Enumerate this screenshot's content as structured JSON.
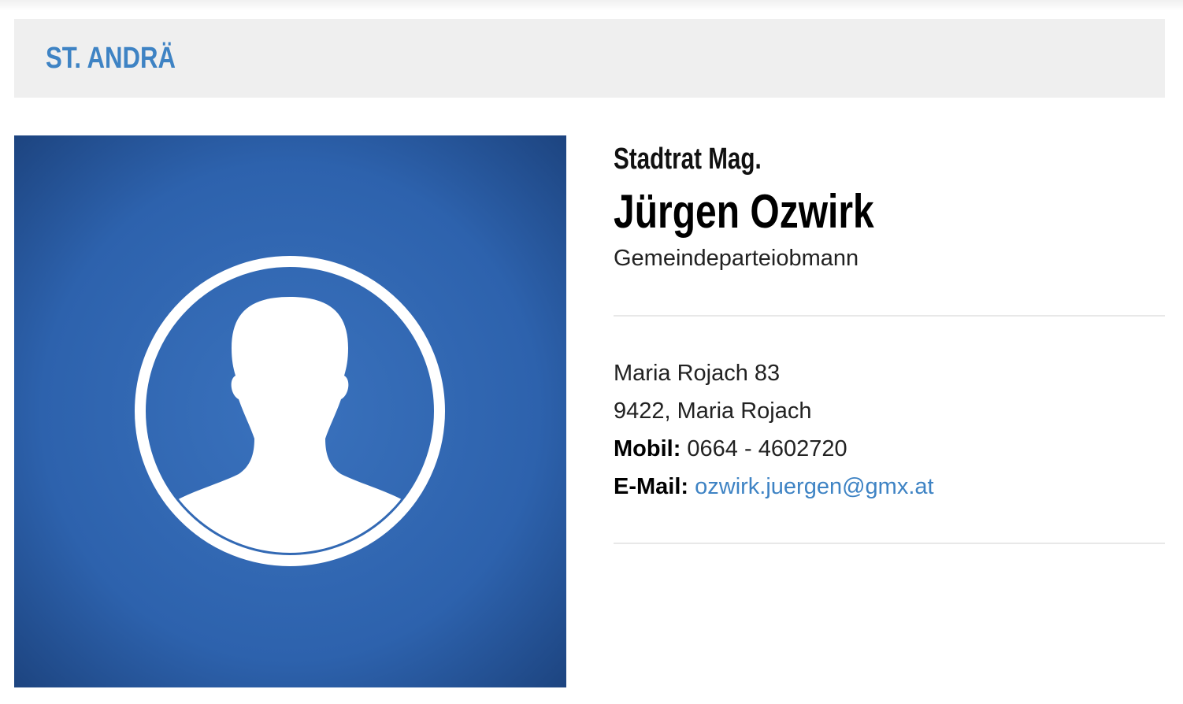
{
  "header": {
    "title": "ST. ANDRÄ"
  },
  "person": {
    "pre_title": "Stadtrat Mag.",
    "name": "Jürgen Ozwirk",
    "role": "Gemeindeparteiobmann",
    "photo_icon": "avatar-placeholder-icon"
  },
  "contact": {
    "street": "Maria Rojach 83",
    "city": "9422, Maria Rojach",
    "mobile_label": "Mobil:",
    "mobile_value": "0664 - 4602720",
    "email_label": "E-Mail:",
    "email_value": "ozwirk.juergen@gmx.at"
  },
  "colors": {
    "accent": "#3e83c4",
    "header_bg": "#efefef",
    "photo_bg": "#2b5ea6"
  }
}
